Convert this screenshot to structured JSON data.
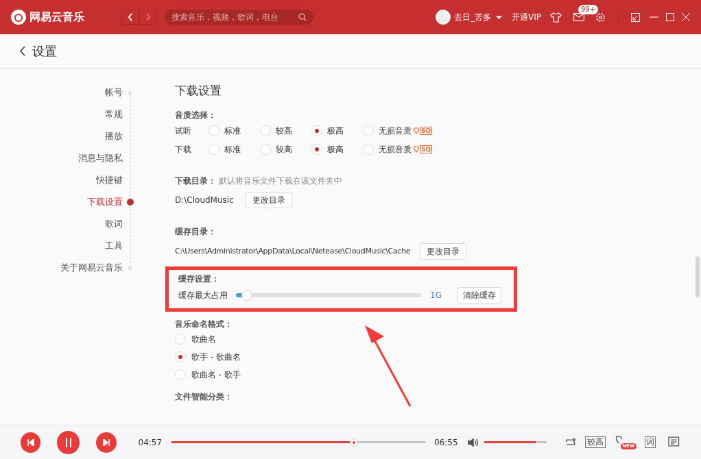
{
  "app": {
    "name": "网易云音乐",
    "search_placeholder": "搜索音乐，视频，歌词，电台",
    "user": "去日_苦多",
    "vip": "开通VIP",
    "mail_badge": "99+"
  },
  "page": {
    "title": "设置"
  },
  "sidebar": {
    "items": [
      {
        "label": "帐号",
        "selected": false
      },
      {
        "label": "常规",
        "selected": false
      },
      {
        "label": "播放",
        "selected": false
      },
      {
        "label": "消息与隐私",
        "selected": false
      },
      {
        "label": "快捷键",
        "selected": false
      },
      {
        "label": "下载设置",
        "selected": true
      },
      {
        "label": "歌词",
        "selected": false
      },
      {
        "label": "工具",
        "selected": false
      },
      {
        "label": "关于网易云音乐",
        "selected": false
      }
    ]
  },
  "section_title": "下载设置",
  "quality": {
    "title": "音质选择：",
    "rows": [
      {
        "label": "试听",
        "badge": "SQ",
        "options": [
          {
            "label": "标准",
            "selected": false
          },
          {
            "label": "较高",
            "selected": false
          },
          {
            "label": "极高",
            "selected": true
          },
          {
            "label": "无损音质",
            "selected": false
          }
        ]
      },
      {
        "label": "下载",
        "badge": "SQ",
        "options": [
          {
            "label": "标准",
            "selected": false
          },
          {
            "label": "较高",
            "selected": false
          },
          {
            "label": "极高",
            "selected": true
          },
          {
            "label": "无损音质",
            "selected": false
          }
        ]
      }
    ]
  },
  "download_dir": {
    "title": "下载目录：",
    "hint": "默认将音乐文件下载在该文件夹中",
    "path": "D:\\CloudMusic",
    "button": "更改目录"
  },
  "cache_dir": {
    "title": "缓存目录：",
    "path": "C:\\Users\\Administrator\\AppData\\Local\\Netease\\CloudMusic\\Cache",
    "button": "更改目录"
  },
  "cache": {
    "title": "缓存设置：",
    "label": "缓存最大占用",
    "level": 0.06,
    "reading": "1G",
    "button": "清除缓存",
    "highlighted": true
  },
  "naming": {
    "title": "音乐命名格式：",
    "options": [
      {
        "label": "歌曲名",
        "selected": false
      },
      {
        "label": "歌手 - 歌曲名",
        "selected": true
      },
      {
        "label": "歌曲名 - 歌手",
        "selected": false
      }
    ]
  },
  "classify": {
    "title": "文件智能分类："
  },
  "player": {
    "elapsed": "04:57",
    "total": "06:55",
    "progress": {
      "level": 0.72
    },
    "volume": {
      "level": 0.83
    },
    "quality": "较高",
    "new_badge": "NEW",
    "lyrics": "词"
  }
}
